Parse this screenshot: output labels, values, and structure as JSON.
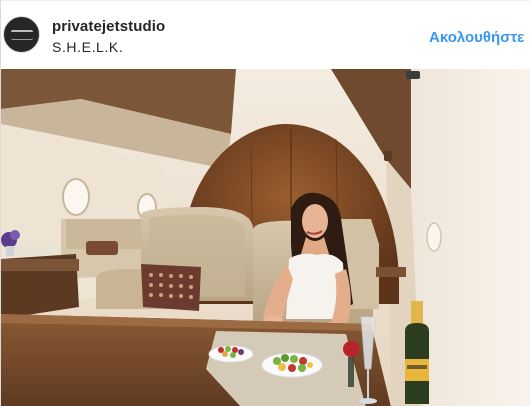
{
  "post": {
    "username": "privatejetstudio",
    "location": "S.H.E.L.K.",
    "follow_label": "Ακολουθήστε"
  },
  "icons": {
    "avatar": "private-jet-studio-logo"
  },
  "colors": {
    "link_blue": "#3897f0",
    "text": "#262626",
    "border": "#dbdbdb"
  }
}
